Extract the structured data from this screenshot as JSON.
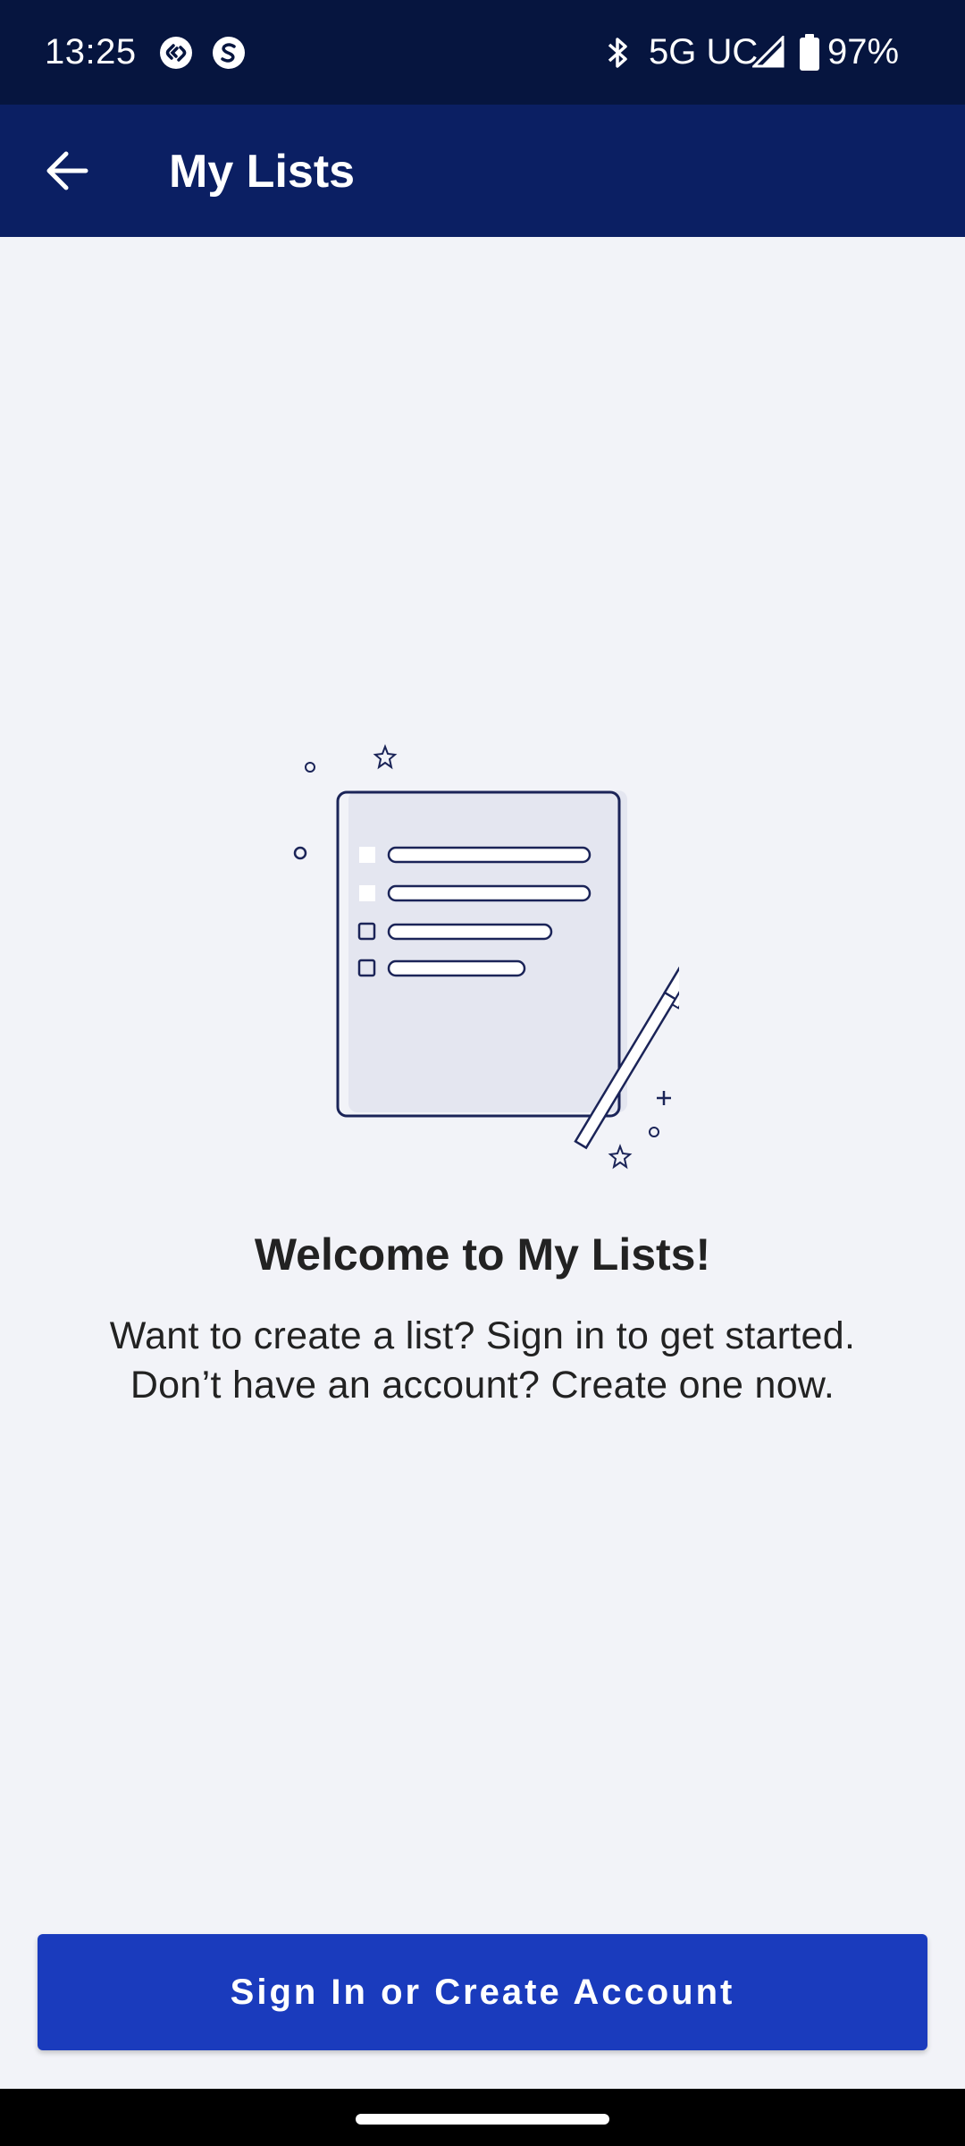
{
  "status_bar": {
    "time": "13:25",
    "app_icons": [
      "shazam-icon",
      "s-circle-icon"
    ],
    "network": "5G UC",
    "battery": "97%",
    "icons": [
      "bluetooth-icon",
      "signal-icon",
      "battery-icon"
    ]
  },
  "app_bar": {
    "title": "My Lists",
    "back_icon": "arrow-back-icon"
  },
  "empty_state": {
    "title": "Welcome to My Lists!",
    "lines": [
      "Want to create a list? Sign in to get started.",
      "Don’t have an account? Create one now."
    ]
  },
  "cta": {
    "label": "Sign In or Create Account"
  },
  "colors": {
    "status_bar_bg": "#06153f",
    "app_bar_bg": "#0b1f63",
    "page_bg": "#f2f3f8",
    "button_bg": "#1a3bbd",
    "illustration_stroke": "#1b2458",
    "illustration_fill": "#e4e6f0"
  }
}
